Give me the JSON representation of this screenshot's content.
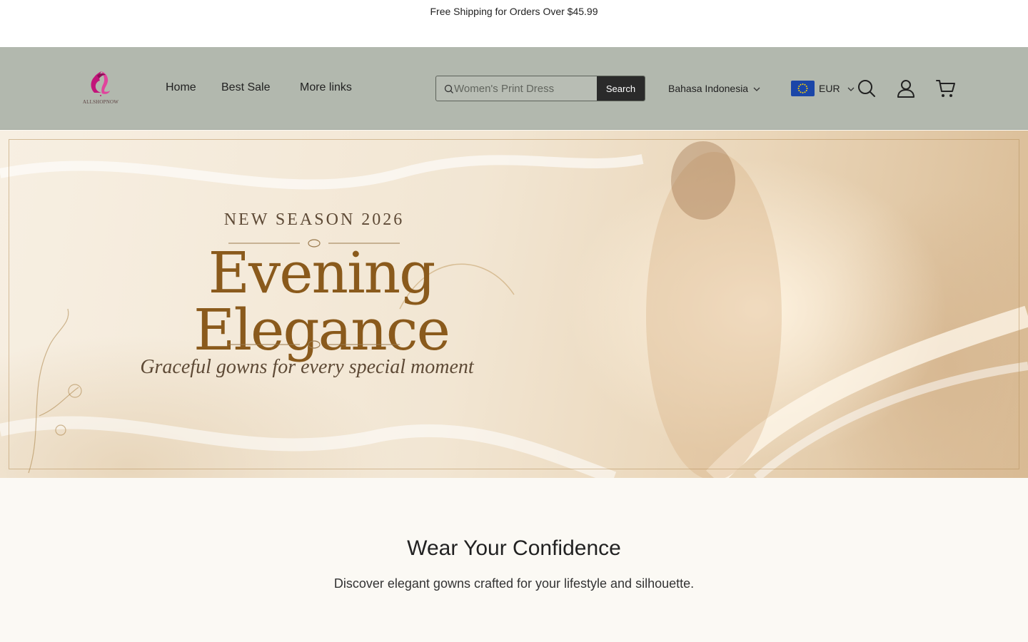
{
  "announcement": {
    "text": "Free Shipping for Orders Over $45.99"
  },
  "header": {
    "logo_text": "ALLSHOPNOW",
    "nav": [
      {
        "label": "Home"
      },
      {
        "label": "Best Sale"
      },
      {
        "label": "More links"
      }
    ],
    "search": {
      "placeholder": "Women's Print Dress",
      "button_label": "Search"
    },
    "language": "Bahasa Indonesia",
    "currency": "EUR"
  },
  "hero": {
    "kicker": "NEW SEASON 2026",
    "title": "Evening Elegance",
    "subtitle": "Graceful gowns for every special moment"
  },
  "section": {
    "title": "Wear Your Confidence",
    "subtitle": "Discover elegant gowns crafted for your lifestyle and silhouette."
  },
  "colors": {
    "header_bg": "#b2b8ae",
    "search_button": "#2a2a2a",
    "logo_accent": "#c2157a",
    "flag_blue": "#1b46a8",
    "hero_gold": "#8a5a1c"
  },
  "icons": [
    "search-icon",
    "user-icon",
    "cart-icon",
    "chevron-down-icon",
    "eu-flag-icon",
    "logo-icon"
  ]
}
